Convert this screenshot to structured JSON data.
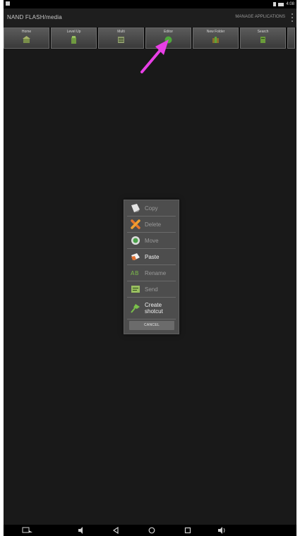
{
  "app": {
    "title": "NAND FLASH/media",
    "manage_label": "MANAGE APPLICATIONS",
    "status_time": "4:08"
  },
  "toolbar": [
    {
      "label": "Home",
      "icon": "home-icon",
      "color": "#6b8e3a"
    },
    {
      "label": "Level Up",
      "icon": "level-up-icon",
      "color": "#7ba64a"
    },
    {
      "label": "Multi",
      "icon": "multi-select-icon",
      "color": "#8a9a6a"
    },
    {
      "label": "Editor",
      "icon": "editor-icon",
      "color": "#4ea83a"
    },
    {
      "label": "New Folder",
      "icon": "new-folder-icon",
      "color": "#8a7a2a"
    },
    {
      "label": "Search",
      "icon": "search-icon",
      "color": "#6aa83a"
    }
  ],
  "menu": {
    "items": [
      {
        "label": "Copy",
        "icon": "copy-icon",
        "enabled": false
      },
      {
        "label": "Delete",
        "icon": "delete-icon",
        "enabled": false
      },
      {
        "label": "Move",
        "icon": "move-icon",
        "enabled": false
      },
      {
        "label": "Paste",
        "icon": "paste-icon",
        "enabled": true
      },
      {
        "label": "Rename",
        "icon": "rename-icon",
        "enabled": false
      },
      {
        "label": "Send",
        "icon": "send-icon",
        "enabled": false
      },
      {
        "label": "Create\nshotcut",
        "icon": "pin-icon",
        "enabled": true
      }
    ],
    "cancel_label": "CANCEL"
  },
  "colors": {
    "background": "#191919",
    "accent_arrow": "#e83fe6"
  }
}
